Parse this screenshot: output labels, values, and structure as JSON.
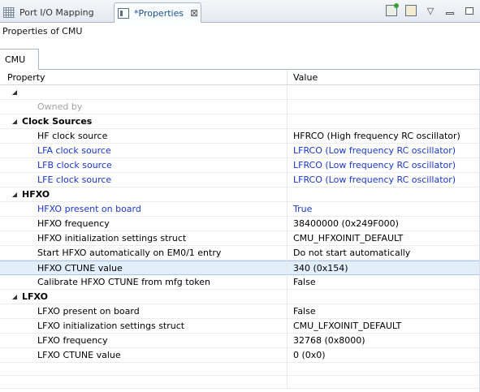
{
  "tabs": {
    "inactive_label": "Port I/O Mapping",
    "active_label": "*Properties",
    "close_glyph": "⊠"
  },
  "view_title": "Properties of CMU",
  "subtab_label": "CMU",
  "columns": {
    "property": "Property",
    "value": "Value"
  },
  "rows": [
    {
      "kind": "group",
      "label": "",
      "value": ""
    },
    {
      "kind": "leaf",
      "label": "Owned by",
      "value": "",
      "style": "gray"
    },
    {
      "kind": "group",
      "label": "Clock Sources",
      "value": ""
    },
    {
      "kind": "leaf",
      "label": "HF clock source",
      "value": "HFRCO (High frequency RC oscillator)",
      "style": ""
    },
    {
      "kind": "leaf",
      "label": "LFA clock source",
      "value": "LFRCO (Low frequency RC oscillator)",
      "style": "blue"
    },
    {
      "kind": "leaf",
      "label": "LFB clock source",
      "value": "LFRCO (Low frequency RC oscillator)",
      "style": "blue"
    },
    {
      "kind": "leaf",
      "label": "LFE clock source",
      "value": "LFRCO (Low frequency RC oscillator)",
      "style": "blue"
    },
    {
      "kind": "group",
      "label": "HFXO",
      "value": ""
    },
    {
      "kind": "leaf",
      "label": "HFXO present on board",
      "value": "True",
      "style": "blue"
    },
    {
      "kind": "leaf",
      "label": "HFXO frequency",
      "value": "38400000 (0x249F000)",
      "style": ""
    },
    {
      "kind": "leaf",
      "label": "HFXO initialization settings struct",
      "value": "CMU_HFXOINIT_DEFAULT",
      "style": ""
    },
    {
      "kind": "leaf",
      "label": "Start HFXO automatically on EM0/1 entry",
      "value": "Do not start automatically",
      "style": ""
    },
    {
      "kind": "leaf",
      "label": "HFXO CTUNE value",
      "value": "340 (0x154)",
      "style": "",
      "selected": true
    },
    {
      "kind": "leaf",
      "label": "Calibrate HFXO CTUNE from mfg token",
      "value": "False",
      "style": ""
    },
    {
      "kind": "group",
      "label": "LFXO",
      "value": ""
    },
    {
      "kind": "leaf",
      "label": "LFXO present on board",
      "value": "False",
      "style": ""
    },
    {
      "kind": "leaf",
      "label": "LFXO initialization settings struct",
      "value": "CMU_LFXOINIT_DEFAULT",
      "style": ""
    },
    {
      "kind": "leaf",
      "label": "LFXO frequency",
      "value": "32768 (0x8000)",
      "style": ""
    },
    {
      "kind": "leaf",
      "label": "LFXO CTUNE value",
      "value": "0 (0x0)",
      "style": ""
    }
  ],
  "icons": {
    "tab_inactive": "grid-icon",
    "tab_active": "properties-icon",
    "toolbar": [
      "pin-view-icon",
      "filter-icon",
      "view-menu-icon",
      "minimize-icon",
      "maximize-icon"
    ]
  }
}
